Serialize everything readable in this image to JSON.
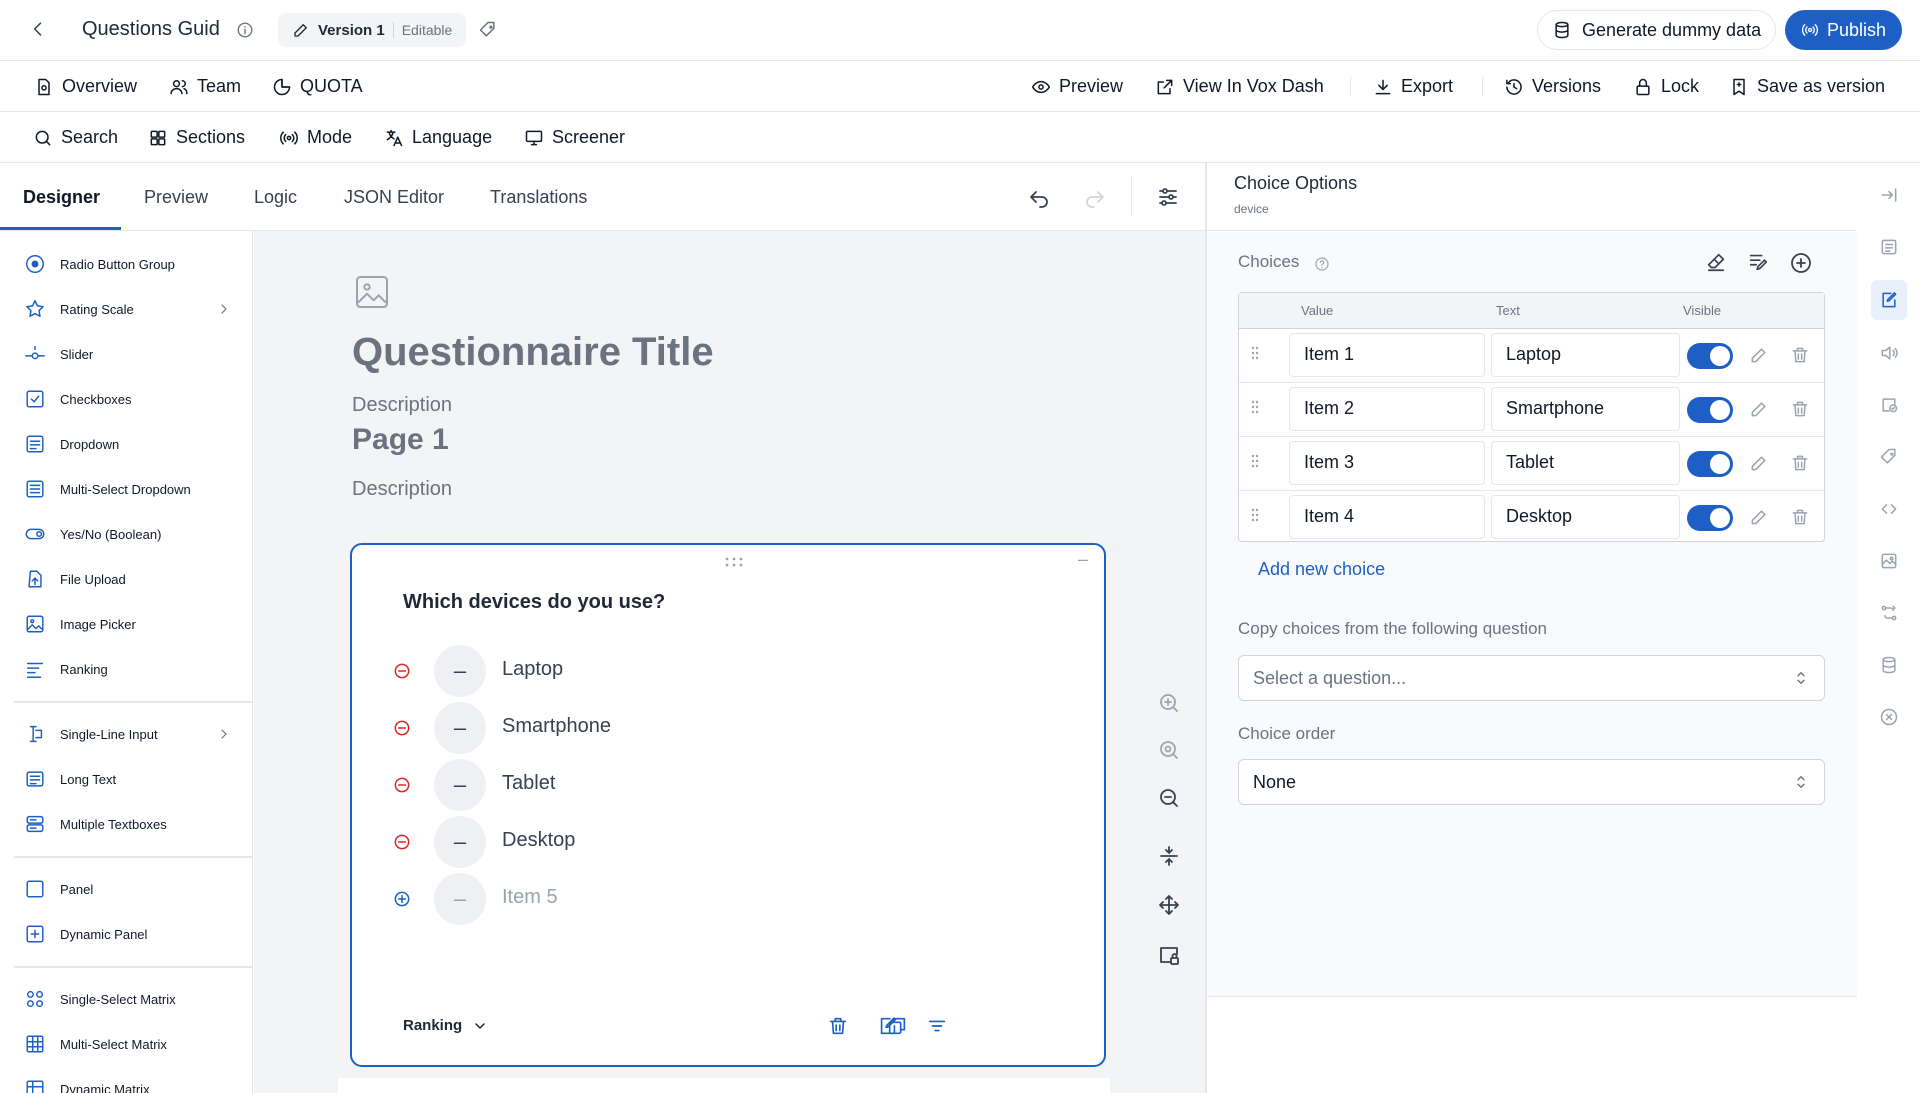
{
  "header": {
    "title": "Questions Guid",
    "version_label": "Version 1",
    "version_state": "Editable",
    "generate_label": "Generate dummy data",
    "publish_label": "Publish"
  },
  "nav": {
    "overview": "Overview",
    "team": "Team",
    "quota": "QUOTA",
    "preview": "Preview",
    "view_in_vox": "View In Vox Dash",
    "export": "Export",
    "versions": "Versions",
    "lock": "Lock",
    "save_version": "Save as version"
  },
  "toolbar": {
    "search": "Search",
    "sections": "Sections",
    "mode": "Mode",
    "language": "Language",
    "screener": "Screener"
  },
  "tabs": [
    {
      "label": "Designer"
    },
    {
      "label": "Preview"
    },
    {
      "label": "Logic"
    },
    {
      "label": "JSON Editor"
    },
    {
      "label": "Translations"
    }
  ],
  "palette": [
    {
      "label": "Radio Button Group",
      "icon": "radio-icon"
    },
    {
      "label": "Rating Scale",
      "icon": "star-icon"
    },
    {
      "label": "Slider",
      "icon": "slider-icon"
    },
    {
      "label": "Checkboxes",
      "icon": "checkbox-icon"
    },
    {
      "label": "Dropdown",
      "icon": "dropdown-icon"
    },
    {
      "label": "Multi-Select Dropdown",
      "icon": "multiselect-icon"
    },
    {
      "label": "Yes/No (Boolean)",
      "icon": "toggle-icon"
    },
    {
      "label": "File Upload",
      "icon": "upload-icon"
    },
    {
      "label": "Image Picker",
      "icon": "image-picker-icon"
    },
    {
      "label": "Ranking",
      "icon": "ranking-icon"
    },
    {
      "label": "Single-Line Input",
      "icon": "text-cursor-icon"
    },
    {
      "label": "Long Text",
      "icon": "long-text-icon"
    },
    {
      "label": "Multiple Textboxes",
      "icon": "textboxes-icon"
    },
    {
      "label": "Panel",
      "icon": "panel-icon"
    },
    {
      "label": "Dynamic Panel",
      "icon": "dynamic-panel-icon"
    },
    {
      "label": "Single-Select Matrix",
      "icon": "matrix-icon"
    },
    {
      "label": "Multi-Select Matrix",
      "icon": "grid-icon"
    },
    {
      "label": "Dynamic Matrix",
      "icon": "dynamic-matrix-icon"
    }
  ],
  "survey": {
    "title": "Questionnaire Title",
    "description": "Description",
    "page_title": "Page 1",
    "page_description": "Description"
  },
  "question": {
    "text": "Which devices do you use?",
    "type_label": "Ranking",
    "items": [
      {
        "label": "Laptop",
        "rank": "–"
      },
      {
        "label": "Smartphone",
        "rank": "–"
      },
      {
        "label": "Tablet",
        "rank": "–"
      },
      {
        "label": "Desktop",
        "rank": "–"
      },
      {
        "label": "Item 5",
        "rank": "–"
      }
    ]
  },
  "right_panel": {
    "title": "Choice Options",
    "subtitle": "device",
    "choices_label": "Choices",
    "col_value": "Value",
    "col_text": "Text",
    "col_visible": "Visible",
    "choices": [
      {
        "value": "Item 1",
        "text": "Laptop",
        "visible": true
      },
      {
        "value": "Item 2",
        "text": "Smartphone",
        "visible": true
      },
      {
        "value": "Item 3",
        "text": "Tablet",
        "visible": true
      },
      {
        "value": "Item 4",
        "text": "Desktop",
        "visible": true
      }
    ],
    "add_choice": "Add new choice",
    "copy_label": "Copy choices from the following question",
    "copy_placeholder": "Select a question...",
    "order_label": "Choice order",
    "order_value": "None"
  },
  "colors": {
    "accent": "#1d5fc4",
    "danger": "#dc2626",
    "canvas_bg": "#f3f4f6"
  }
}
